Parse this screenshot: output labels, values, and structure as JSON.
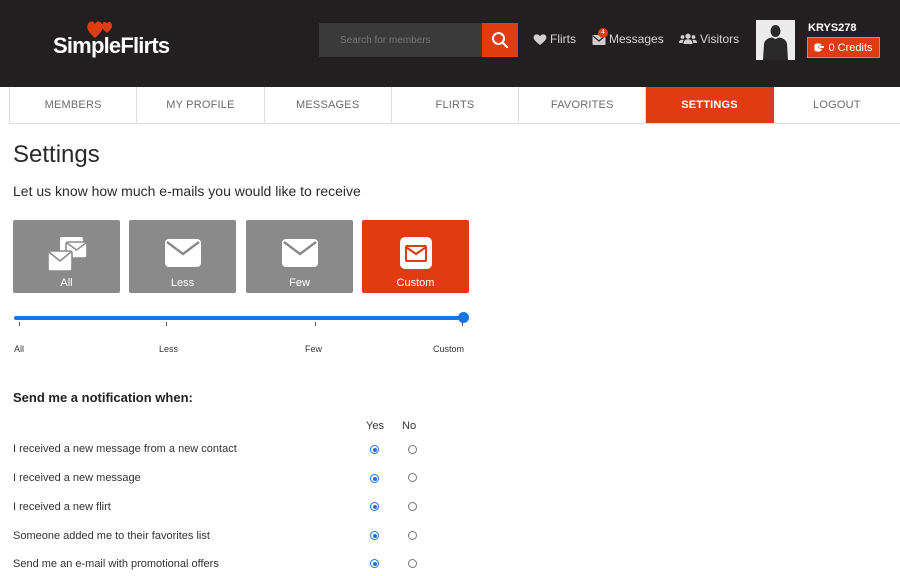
{
  "header": {
    "logo_text": "SimpleFlirts",
    "search_placeholder": "Search for members",
    "nav": {
      "flirts": "Flirts",
      "messages": "Messages",
      "messages_badge": "4",
      "visitors": "Visitors"
    },
    "username": "KRYS278",
    "credits": "0 Credits"
  },
  "tabs": [
    {
      "label": "MEMBERS",
      "active": false
    },
    {
      "label": "MY PROFILE",
      "active": false
    },
    {
      "label": "MESSAGES",
      "active": false
    },
    {
      "label": "FLIRTS",
      "active": false
    },
    {
      "label": "FAVORITES",
      "active": false
    },
    {
      "label": "SETTINGS",
      "active": true
    },
    {
      "label": "LOGOUT",
      "active": false
    }
  ],
  "settings": {
    "title": "Settings",
    "subtitle": "Let us know how much e-mails you would like to receive",
    "frequency_options": [
      {
        "label": "All",
        "icon": "multiple-envelopes-icon"
      },
      {
        "label": "Less",
        "icon": "envelope-icon"
      },
      {
        "label": "Few",
        "icon": "envelope-icon"
      },
      {
        "label": "Custom",
        "icon": "envelope-square-icon"
      }
    ],
    "frequency_selected": "Custom",
    "slider_value_fraction": 1.0,
    "slider_labels": [
      "All",
      "Less",
      "Few",
      "Custom"
    ]
  },
  "notifications": {
    "title": "Send me a notification when:",
    "col_yes": "Yes",
    "col_no": "No",
    "rows": [
      {
        "label": "I received a new message from a new contact",
        "value": "yes"
      },
      {
        "label": "I received a new message",
        "value": "yes"
      },
      {
        "label": "I received a new flirt",
        "value": "yes"
      },
      {
        "label": "Someone added me to their favorites list",
        "value": "yes"
      },
      {
        "label": "Send me an e-mail with promotional offers",
        "value": "yes"
      }
    ]
  },
  "colors": {
    "accent": "#e03c12",
    "header_bg": "#231f20",
    "tile_gray": "#8a8a8a",
    "slider_blue": "#1a73e8"
  }
}
